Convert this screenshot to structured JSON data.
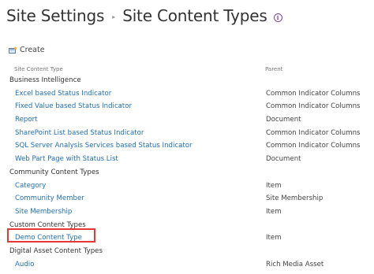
{
  "breadcrumb": {
    "root": "Site Settings",
    "separator": "▸",
    "current": "Site Content Types",
    "info_icon": "info-icon"
  },
  "toolbar": {
    "create_label": "Create",
    "create_icon": "create-icon"
  },
  "table": {
    "headers": {
      "name": "Site Content Type",
      "parent": "Parent"
    },
    "rows": [
      {
        "type": "group",
        "name": "Business Intelligence",
        "parent": ""
      },
      {
        "type": "item",
        "name": "Excel based Status Indicator",
        "parent": "Common Indicator Columns"
      },
      {
        "type": "item",
        "name": "Fixed Value based Status Indicator",
        "parent": "Common Indicator Columns"
      },
      {
        "type": "item",
        "name": "Report",
        "parent": "Document"
      },
      {
        "type": "item",
        "name": "SharePoint List based Status Indicator",
        "parent": "Common Indicator Columns"
      },
      {
        "type": "item",
        "name": "SQL Server Analysis Services based Status Indicator",
        "parent": "Common Indicator Columns"
      },
      {
        "type": "item",
        "name": "Web Part Page with Status List",
        "parent": "Document"
      },
      {
        "type": "group",
        "name": "Community Content Types",
        "parent": ""
      },
      {
        "type": "item",
        "name": "Category",
        "parent": "Item"
      },
      {
        "type": "item",
        "name": "Community Member",
        "parent": "Site Membership"
      },
      {
        "type": "item",
        "name": "Site Membership",
        "parent": "Item"
      },
      {
        "type": "group",
        "name": "Custom Content Types",
        "parent": ""
      },
      {
        "type": "item",
        "name": "Demo Content Type",
        "parent": "Item"
      },
      {
        "type": "group",
        "name": "Digital Asset Content Types",
        "parent": ""
      },
      {
        "type": "item",
        "name": "Audio",
        "parent": "Rich Media Asset"
      }
    ]
  },
  "colors": {
    "link": "#1f6fb5",
    "highlight": "#e53935",
    "info_icon": "#7a3fb0"
  }
}
